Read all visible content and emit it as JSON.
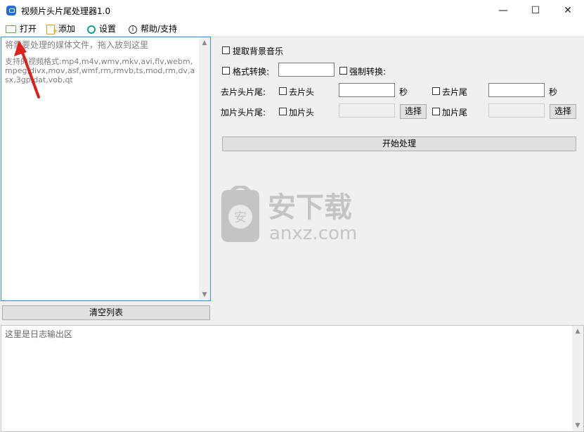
{
  "window": {
    "title": "视频片头片尾处理器1.0",
    "controls": {
      "minimize": "—",
      "maximize": "☐",
      "close": "✕"
    }
  },
  "menu": {
    "open": "打开",
    "add": "添加",
    "settings": "设置",
    "help": "帮助/支持",
    "icons": [
      "folder-open-icon",
      "add-file-icon",
      "gear-icon",
      "info-icon"
    ]
  },
  "file_list": {
    "hint": "将需要处理的媒体文件，拖入放到这里",
    "support_text": "支持的视频格式:mp4,m4v,wmv,mkv,avi,flv,webm,mpeg,divx,mov,asf,wmf,rm,rmvb,ts,mod,rm,dv,asx,3gp,dat,vob,qt"
  },
  "clear_button": "清空列表",
  "options": {
    "extract_bg_music": "提取背景音乐",
    "format_convert": "格式转换:",
    "force_convert": "强制转换:",
    "remove_label": "去片头片尾:",
    "remove_head": "去片头",
    "remove_tail": "去片尾",
    "seconds": "秒",
    "add_label": "加片头片尾:",
    "add_head": "加片头",
    "add_tail": "加片尾",
    "select": "选择"
  },
  "start_button": "开始处理",
  "log": {
    "placeholder": "这里是日志输出区"
  },
  "watermark": {
    "text": "安下载",
    "domain": "anxz.com",
    "badge": "安"
  },
  "colors": {
    "accent_border": "#3b8ddb",
    "annotation_arrow": "#e0201b"
  }
}
